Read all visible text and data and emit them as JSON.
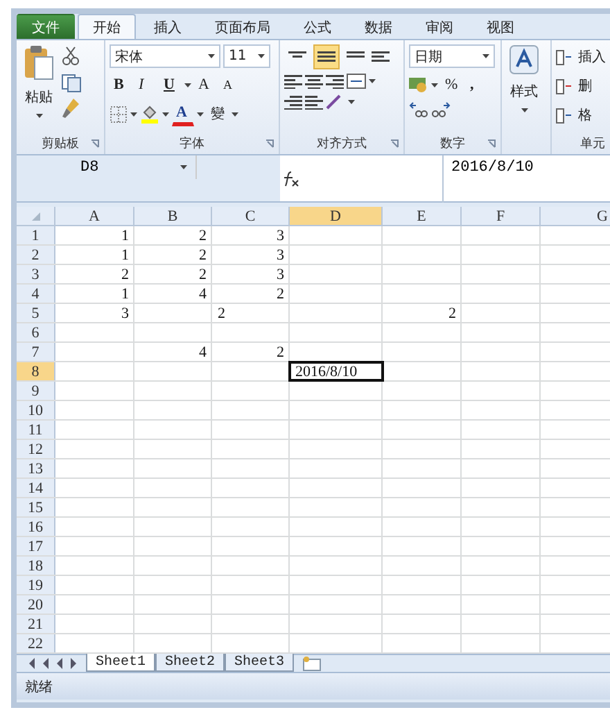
{
  "ribbon_tabs": [
    {
      "label": "文件",
      "kind": "file",
      "selected": false
    },
    {
      "label": "开始",
      "kind": "tab",
      "selected": true
    },
    {
      "label": "插入",
      "kind": "tab",
      "selected": false
    },
    {
      "label": "页面布局",
      "kind": "tab",
      "selected": false
    },
    {
      "label": "公式",
      "kind": "tab",
      "selected": false
    },
    {
      "label": "数据",
      "kind": "tab",
      "selected": false
    },
    {
      "label": "审阅",
      "kind": "tab",
      "selected": false
    },
    {
      "label": "视图",
      "kind": "tab",
      "selected": false
    }
  ],
  "ribbon_groups": [
    {
      "kind": "clipboard",
      "label": "剪贴板",
      "paste": "粘贴"
    },
    {
      "kind": "font",
      "label": "字体",
      "font_name": "宋体",
      "font_size": "11",
      "bold": "B",
      "italic": "I",
      "underline": "U",
      "grow": "A",
      "shrink": "A",
      "font_color": "A",
      "phonetic": "變"
    },
    {
      "kind": "alignment",
      "label": "对齐方式",
      "vertical_align": [
        {
          "selected": false
        },
        {
          "selected": true
        },
        {
          "selected": false
        }
      ]
    },
    {
      "kind": "number",
      "label": "数字",
      "format": "日期",
      "percent": "%",
      "comma": ","
    },
    {
      "kind": "styles",
      "button": "样式"
    },
    {
      "kind": "cells",
      "label": "单元",
      "items": [
        "插入",
        "删",
        "格"
      ]
    }
  ],
  "formula_bar": {
    "name_box": "D8",
    "formula": "2016/8/10"
  },
  "columns": [
    {
      "label": "A",
      "selected": false
    },
    {
      "label": "B",
      "selected": false
    },
    {
      "label": "C",
      "selected": false
    },
    {
      "label": "D",
      "selected": true
    },
    {
      "label": "E",
      "selected": false
    },
    {
      "label": "F",
      "selected": false
    },
    {
      "label": "G",
      "selected": false
    }
  ],
  "rows": [
    {
      "label": "1",
      "selected": false,
      "cells": [
        {
          "text": "1",
          "kind": "number"
        },
        {
          "text": "2",
          "kind": "number"
        },
        {
          "text": "3",
          "kind": "number"
        },
        null,
        null,
        null,
        null
      ]
    },
    {
      "label": "2",
      "selected": false,
      "cells": [
        {
          "text": "1",
          "kind": "number"
        },
        {
          "text": "2",
          "kind": "number"
        },
        {
          "text": "3",
          "kind": "number"
        },
        null,
        null,
        null,
        null
      ]
    },
    {
      "label": "3",
      "selected": false,
      "cells": [
        {
          "text": "2",
          "kind": "number"
        },
        {
          "text": "2",
          "kind": "number"
        },
        {
          "text": "3",
          "kind": "number"
        },
        null,
        null,
        null,
        null
      ]
    },
    {
      "label": "4",
      "selected": false,
      "cells": [
        {
          "text": "1",
          "kind": "number"
        },
        {
          "text": "4",
          "kind": "number"
        },
        {
          "text": "2",
          "kind": "number"
        },
        null,
        null,
        null,
        null
      ]
    },
    {
      "label": "5",
      "selected": false,
      "cells": [
        {
          "text": "3",
          "kind": "number"
        },
        null,
        {
          "text": "2",
          "kind": "text"
        },
        null,
        {
          "text": "2",
          "kind": "number"
        },
        null,
        null
      ]
    },
    {
      "label": "6",
      "selected": false,
      "cells": [
        null,
        null,
        null,
        null,
        null,
        null,
        null
      ]
    },
    {
      "label": "7",
      "selected": false,
      "cells": [
        null,
        {
          "text": "4",
          "kind": "number"
        },
        {
          "text": "2",
          "kind": "number"
        },
        null,
        null,
        null,
        null
      ]
    },
    {
      "label": "8",
      "selected": true,
      "cells": [
        null,
        null,
        null,
        {
          "text": "2016/8/10",
          "kind": "text",
          "selected": true
        },
        null,
        null,
        null
      ]
    },
    {
      "label": "9",
      "selected": false
    },
    {
      "label": "10",
      "selected": false
    },
    {
      "label": "11",
      "selected": false
    },
    {
      "label": "12",
      "selected": false
    },
    {
      "label": "13",
      "selected": false
    },
    {
      "label": "14",
      "selected": false
    },
    {
      "label": "15",
      "selected": false
    },
    {
      "label": "16",
      "selected": false
    },
    {
      "label": "17",
      "selected": false
    },
    {
      "label": "18",
      "selected": false
    },
    {
      "label": "19",
      "selected": false
    },
    {
      "label": "20",
      "selected": false
    },
    {
      "label": "21",
      "selected": false
    },
    {
      "label": "22",
      "selected": false
    }
  ],
  "sheet_tabs": [
    {
      "label": "Sheet1",
      "selected": true
    },
    {
      "label": "Sheet2",
      "selected": false
    },
    {
      "label": "Sheet3",
      "selected": false
    }
  ],
  "status_bar": {
    "status": "就绪"
  }
}
